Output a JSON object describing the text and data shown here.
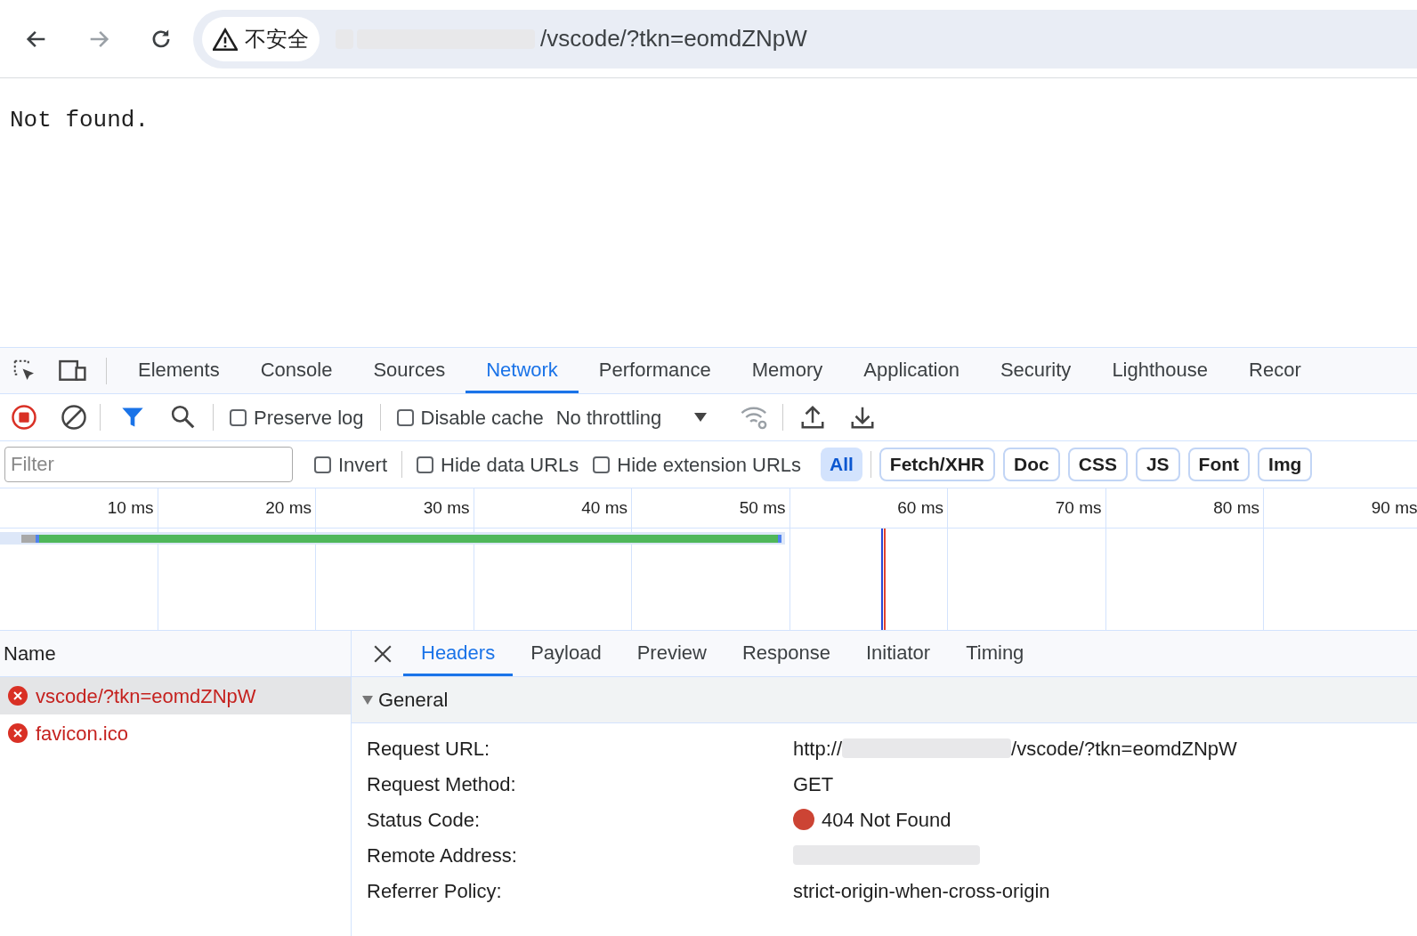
{
  "browser": {
    "security_label": "不安全",
    "address": "/vscode/?tkn=eomdZNpW"
  },
  "page": {
    "text": "Not found."
  },
  "devtools": {
    "tabs": [
      {
        "label": "Elements",
        "selected": false
      },
      {
        "label": "Console",
        "selected": false
      },
      {
        "label": "Sources",
        "selected": false
      },
      {
        "label": "Network",
        "selected": true
      },
      {
        "label": "Performance",
        "selected": false
      },
      {
        "label": "Memory",
        "selected": false
      },
      {
        "label": "Application",
        "selected": false
      },
      {
        "label": "Security",
        "selected": false
      },
      {
        "label": "Lighthouse",
        "selected": false
      },
      {
        "label": "Recor",
        "selected": false
      }
    ],
    "toolbar": {
      "preserve_log": {
        "label": "Preserve log",
        "checked": false
      },
      "disable_cache": {
        "label": "Disable cache",
        "checked": false
      },
      "throttling": "No throttling"
    },
    "filter_bar": {
      "placeholder": "Filter",
      "invert": {
        "label": "Invert",
        "checked": false
      },
      "hide_data_urls": {
        "label": "Hide data URLs",
        "checked": false
      },
      "hide_extension_urls": {
        "label": "Hide extension URLs",
        "checked": false
      },
      "types": [
        {
          "label": "All",
          "selected": true
        },
        {
          "label": "Fetch/XHR",
          "selected": false
        },
        {
          "label": "Doc",
          "selected": false
        },
        {
          "label": "CSS",
          "selected": false
        },
        {
          "label": "JS",
          "selected": false
        },
        {
          "label": "Font",
          "selected": false
        },
        {
          "label": "Img",
          "selected": false
        }
      ]
    },
    "timeline": {
      "ticks": [
        "10 ms",
        "20 ms",
        "30 ms",
        "40 ms",
        "50 ms",
        "60 ms",
        "70 ms",
        "80 ms",
        "90 ms"
      ]
    },
    "requests": {
      "column": "Name",
      "rows": [
        {
          "name": "vscode/?tkn=eomdZNpW",
          "selected": true,
          "error": true
        },
        {
          "name": "favicon.ico",
          "selected": false,
          "error": true
        }
      ]
    },
    "details": {
      "tabs": [
        {
          "label": "Headers",
          "selected": true
        },
        {
          "label": "Payload",
          "selected": false
        },
        {
          "label": "Preview",
          "selected": false
        },
        {
          "label": "Response",
          "selected": false
        },
        {
          "label": "Initiator",
          "selected": false
        },
        {
          "label": "Timing",
          "selected": false
        }
      ],
      "section": {
        "title": "General",
        "expanded": true
      },
      "rows": [
        {
          "kind": "url",
          "label": "Request URL:",
          "prefix": "http://",
          "value": "/vscode/?tkn=eomdZNpW"
        },
        {
          "kind": "text",
          "label": "Request Method:",
          "value": "GET"
        },
        {
          "kind": "status",
          "label": "Status Code:",
          "value": "404 Not Found",
          "color": "#cc4434"
        },
        {
          "kind": "hidden",
          "label": "Remote Address:"
        },
        {
          "kind": "text",
          "label": "Referrer Policy:",
          "value": "strict-origin-when-cross-origin"
        }
      ]
    }
  }
}
